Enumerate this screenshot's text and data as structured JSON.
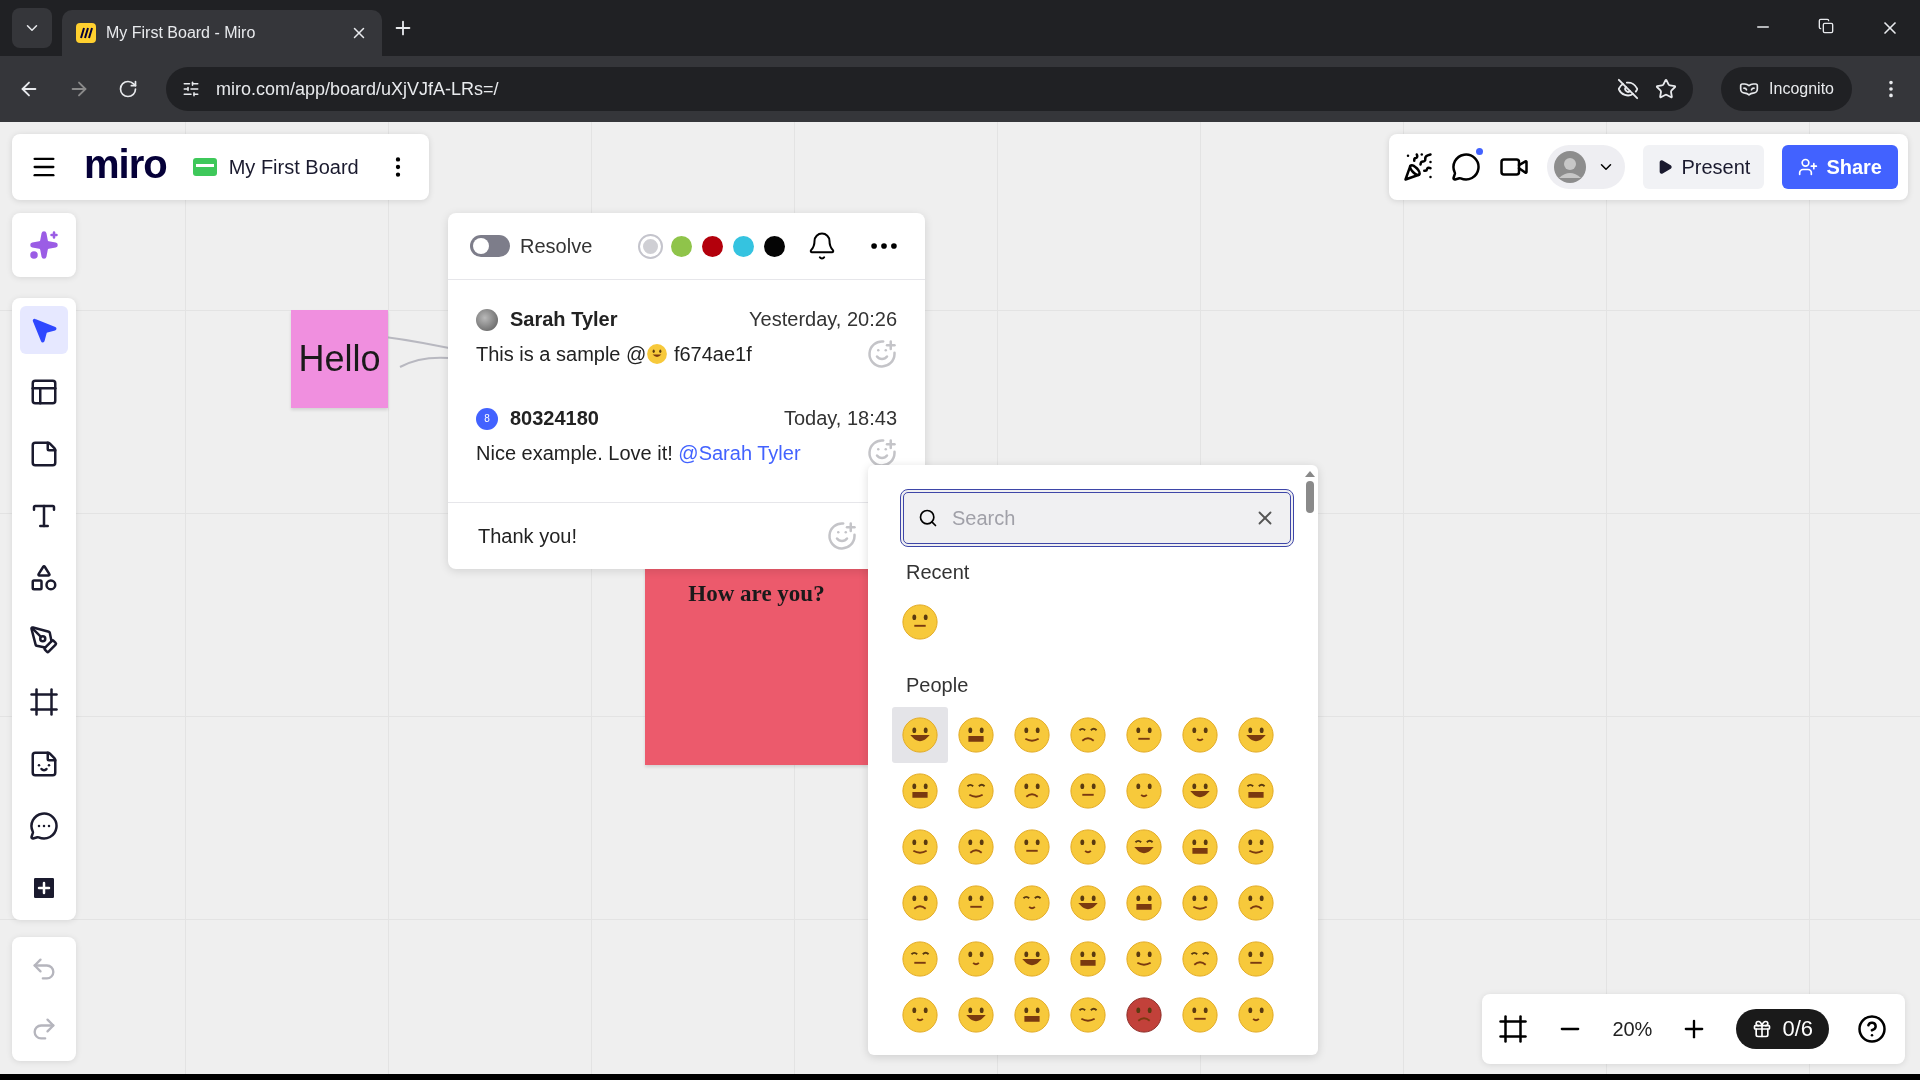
{
  "browser": {
    "tab_title": "My First Board - Miro",
    "url": "miro.com/app/board/uXjVJfA-LRs=/",
    "incognito_label": "Incognito"
  },
  "board_header": {
    "logo": "miro",
    "board_name": "My First Board"
  },
  "top_actions": {
    "present": "Present",
    "share": "Share"
  },
  "toolbar": {
    "tools": [
      {
        "kind": "select",
        "selected": true
      },
      {
        "kind": "templates",
        "selected": false
      },
      {
        "kind": "sticky",
        "selected": false
      },
      {
        "kind": "text",
        "selected": false
      },
      {
        "kind": "shapes",
        "selected": false
      },
      {
        "kind": "pen",
        "selected": false
      },
      {
        "kind": "frame",
        "selected": false
      },
      {
        "kind": "sticker",
        "selected": false
      },
      {
        "kind": "comment",
        "selected": false
      },
      {
        "kind": "more",
        "selected": false
      }
    ]
  },
  "stickies": [
    {
      "kind": "plain",
      "text": "Hello",
      "color": "#f08fdf"
    },
    {
      "kind": "serif",
      "text": "How are you?",
      "color": "#ec5a6c"
    }
  ],
  "comment_thread": {
    "resolve": {
      "label": "Resolve",
      "on": false
    },
    "colors": [
      {
        "color": "#cfcfd4",
        "selected": true
      },
      {
        "color": "#8fc44a",
        "selected": false
      },
      {
        "color": "#b3000c",
        "selected": false
      },
      {
        "color": "#35c3e0",
        "selected": false
      },
      {
        "color": "#050505",
        "selected": false
      }
    ],
    "comments": [
      {
        "author": "Sarah Tyler",
        "kind": "photo",
        "time": "Yesterday, 20:26",
        "body": [
          {
            "kind": "text",
            "text": "This is a sample @"
          },
          {
            "kind": "emoji"
          },
          {
            "kind": "text",
            "text": " f674ae1f"
          }
        ]
      },
      {
        "author": "80324180",
        "kind": "initial",
        "avatar_initial": "8",
        "time": "Today, 18:43",
        "body": [
          {
            "kind": "text",
            "text": "Nice example. Love it! "
          },
          {
            "kind": "mention",
            "text": "@Sarah Tyler"
          }
        ]
      }
    ],
    "reply": {
      "value": "Thank you!"
    }
  },
  "emoji_picker": {
    "search": {
      "placeholder": "Search"
    },
    "sections": [
      {
        "title": "Recent",
        "emojis": [
          {
            "selected": false
          }
        ]
      },
      {
        "title": "People",
        "emojis": [
          {
            "selected": true
          },
          {
            "selected": false
          },
          {
            "selected": false
          },
          {
            "selected": false
          },
          {
            "selected": false
          },
          {
            "selected": false
          },
          {
            "selected": false
          },
          {
            "selected": false
          },
          {
            "selected": false
          },
          {
            "selected": false
          },
          {
            "selected": false
          },
          {
            "selected": false
          },
          {
            "selected": false
          },
          {
            "selected": false
          },
          {
            "selected": false
          },
          {
            "selected": false
          },
          {
            "selected": false
          },
          {
            "selected": false
          },
          {
            "selected": false
          },
          {
            "selected": false
          },
          {
            "selected": false
          },
          {
            "selected": false
          },
          {
            "selected": false
          },
          {
            "selected": false
          },
          {
            "selected": false
          },
          {
            "selected": false
          },
          {
            "selected": false
          },
          {
            "selected": false
          },
          {
            "selected": false
          },
          {
            "selected": false
          },
          {
            "selected": false
          },
          {
            "selected": false
          },
          {
            "selected": false
          },
          {
            "selected": false
          },
          {
            "selected": false
          },
          {
            "selected": false
          },
          {
            "selected": false
          },
          {
            "selected": false
          },
          {
            "selected": false
          },
          {
            "selected": false
          },
          {
            "selected": false
          },
          {
            "selected": false
          }
        ]
      }
    ]
  },
  "zoom_bar": {
    "zoom": "20%",
    "gifts": "0/6"
  }
}
